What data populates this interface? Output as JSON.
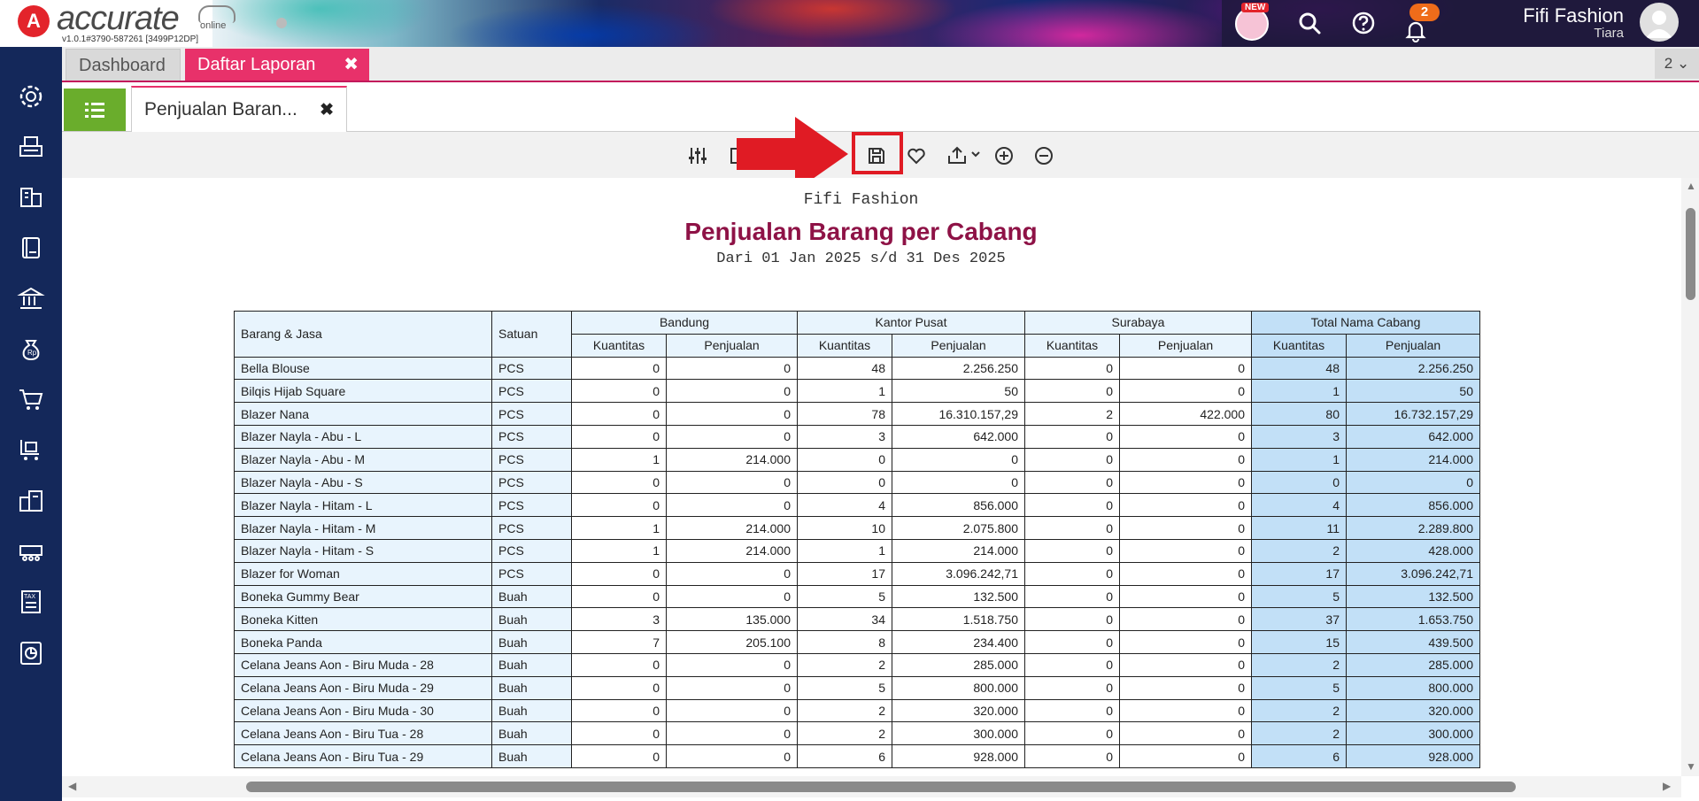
{
  "header": {
    "logo_letter": "A",
    "logo_text": "accurate",
    "logo_online": "online",
    "version": "v1.0.1#3790-587261 [3499P12DP]",
    "new_badge": "NEW",
    "notification_count": "2",
    "company_name": "Fifi Fashion",
    "user_name": "Tiara"
  },
  "tabs": {
    "dashboard": "Dashboard",
    "daftar_laporan": "Daftar Laporan",
    "close_glyph": "✖",
    "count_label": "2 ⌄"
  },
  "subtab": {
    "label": "Penjualan Baran...",
    "close_glyph": "✖"
  },
  "report": {
    "company": "Fifi Fashion",
    "title": "Penjualan Barang per Cabang",
    "period": "Dari 01 Jan 2025 s/d 31 Des 2025",
    "col_item": "Barang & Jasa",
    "col_unit": "Satuan",
    "branches": [
      "Bandung",
      "Kantor Pusat",
      "Surabaya",
      "Total Nama Cabang"
    ],
    "sub_qty": "Kuantitas",
    "sub_sales": "Penjualan",
    "rows": [
      [
        "Bella Blouse",
        "PCS",
        "0",
        "0",
        "48",
        "2.256.250",
        "0",
        "0",
        "48",
        "2.256.250"
      ],
      [
        "Bilqis Hijab Square",
        "PCS",
        "0",
        "0",
        "1",
        "50",
        "0",
        "0",
        "1",
        "50"
      ],
      [
        "Blazer Nana",
        "PCS",
        "0",
        "0",
        "78",
        "16.310.157,29",
        "2",
        "422.000",
        "80",
        "16.732.157,29"
      ],
      [
        "Blazer Nayla - Abu - L",
        "PCS",
        "0",
        "0",
        "3",
        "642.000",
        "0",
        "0",
        "3",
        "642.000"
      ],
      [
        "Blazer Nayla - Abu - M",
        "PCS",
        "1",
        "214.000",
        "0",
        "0",
        "0",
        "0",
        "1",
        "214.000"
      ],
      [
        "Blazer Nayla - Abu - S",
        "PCS",
        "0",
        "0",
        "0",
        "0",
        "0",
        "0",
        "0",
        "0"
      ],
      [
        "Blazer Nayla - Hitam - L",
        "PCS",
        "0",
        "0",
        "4",
        "856.000",
        "0",
        "0",
        "4",
        "856.000"
      ],
      [
        "Blazer Nayla - Hitam - M",
        "PCS",
        "1",
        "214.000",
        "10",
        "2.075.800",
        "0",
        "0",
        "11",
        "2.289.800"
      ],
      [
        "Blazer Nayla - Hitam - S",
        "PCS",
        "1",
        "214.000",
        "1",
        "214.000",
        "0",
        "0",
        "2",
        "428.000"
      ],
      [
        "Blazer for Woman",
        "PCS",
        "0",
        "0",
        "17",
        "3.096.242,71",
        "0",
        "0",
        "17",
        "3.096.242,71"
      ],
      [
        "Boneka Gummy Bear",
        "Buah",
        "0",
        "0",
        "5",
        "132.500",
        "0",
        "0",
        "5",
        "132.500"
      ],
      [
        "Boneka Kitten",
        "Buah",
        "3",
        "135.000",
        "34",
        "1.518.750",
        "0",
        "0",
        "37",
        "1.653.750"
      ],
      [
        "Boneka Panda",
        "Buah",
        "7",
        "205.100",
        "8",
        "234.400",
        "0",
        "0",
        "15",
        "439.500"
      ],
      [
        "Celana Jeans Aon - Biru Muda - 28",
        "Buah",
        "0",
        "0",
        "2",
        "285.000",
        "0",
        "0",
        "2",
        "285.000"
      ],
      [
        "Celana Jeans Aon - Biru Muda - 29",
        "Buah",
        "0",
        "0",
        "5",
        "800.000",
        "0",
        "0",
        "5",
        "800.000"
      ],
      [
        "Celana Jeans Aon - Biru Muda - 30",
        "Buah",
        "0",
        "0",
        "2",
        "320.000",
        "0",
        "0",
        "2",
        "320.000"
      ],
      [
        "Celana Jeans Aon - Biru Tua - 28",
        "Buah",
        "0",
        "0",
        "2",
        "300.000",
        "0",
        "0",
        "2",
        "300.000"
      ],
      [
        "Celana Jeans Aon - Biru Tua - 29",
        "Buah",
        "0",
        "0",
        "6",
        "928.000",
        "0",
        "0",
        "6",
        "928.000"
      ]
    ]
  },
  "colors": {
    "accent_pink": "#e8316a",
    "sidebar": "#14285a",
    "title_maroon": "#8e1246",
    "highlight_red": "#e01b24",
    "total_blue": "#c2e0f7",
    "light_blue": "#e8f4fd",
    "green": "#6aad2c"
  }
}
